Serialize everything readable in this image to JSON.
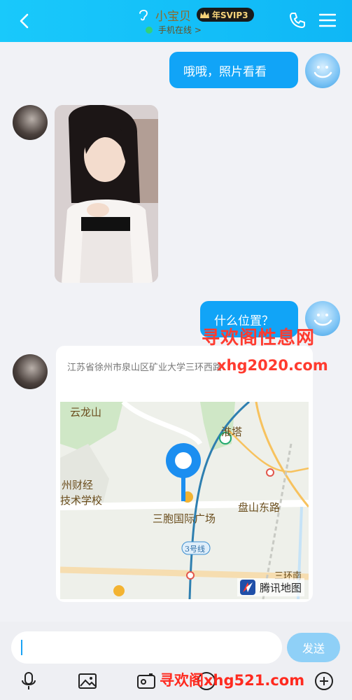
{
  "header": {
    "contact_name": "小宝贝",
    "vip_badge": "年SVIP3",
    "status": "手机在线 >"
  },
  "messages": [
    {
      "from": "self",
      "type": "text",
      "text": "哦哦，照片看看"
    },
    {
      "from": "peer",
      "type": "image"
    },
    {
      "from": "self",
      "type": "text",
      "text": "什么位置？"
    },
    {
      "from": "peer",
      "type": "location",
      "address": "江苏省徐州市泉山区矿业大学三环西路"
    }
  ],
  "map": {
    "labels": {
      "yunlongshan": "云龙山",
      "huaita": "淮塔",
      "caijing": "州财经",
      "jishu": "技术学校",
      "sanpeng": "三胞国际广场",
      "panshan": "盘山东路",
      "line3": "3号线",
      "sanhuan": "三环南"
    },
    "brand": "腾讯地图"
  },
  "watermarks": {
    "top": "寻欢阁性息网",
    "url_top": "xhg2020.com",
    "bottom": "寻欢阁xhg521.com"
  },
  "composer": {
    "input_value": "",
    "send_label": "发送"
  },
  "colors": {
    "header_bg": "#19c9fb",
    "bubble_self": "#11a4f7",
    "send_button": "#8fd0f7",
    "watermark": "#ff3b2f"
  }
}
